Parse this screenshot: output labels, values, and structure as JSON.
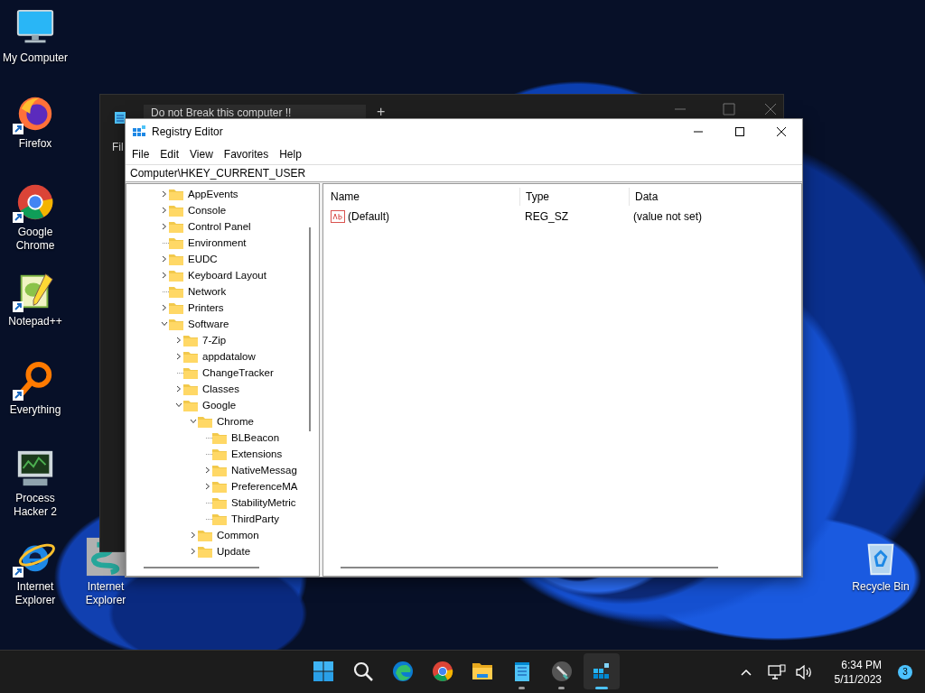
{
  "desktop_icons": [
    {
      "label": "My Computer",
      "kind": "monitor",
      "shortcut": false
    },
    {
      "label": "Firefox",
      "kind": "firefox",
      "shortcut": true
    },
    {
      "label": "Google Chrome",
      "kind": "chrome",
      "shortcut": true
    },
    {
      "label": "Notepad++",
      "kind": "notepadpp",
      "shortcut": true
    },
    {
      "label": "Everything",
      "kind": "magnifier",
      "shortcut": true
    },
    {
      "label": "Process Hacker 2",
      "kind": "hacker",
      "shortcut": false
    },
    {
      "label": "Internet Explorer",
      "kind": "ie",
      "shortcut": true
    },
    {
      "label": "Internet Explorer",
      "kind": "spring",
      "shortcut": false
    },
    {
      "label": "Recycle Bin",
      "kind": "bin",
      "shortcut": false
    }
  ],
  "background_window": {
    "tab_title": "Do not Break this computer !!",
    "new_tab": "+",
    "menu_partial": "Fil"
  },
  "registry_editor": {
    "title": "Registry Editor",
    "menu": [
      "File",
      "Edit",
      "View",
      "Favorites",
      "Help"
    ],
    "address": "Computer\\HKEY_CURRENT_USER",
    "tree": [
      {
        "name": "AppEvents",
        "has_subkeys": true,
        "expanded": false
      },
      {
        "name": "Console",
        "has_subkeys": true,
        "expanded": false
      },
      {
        "name": "Control Panel",
        "has_subkeys": true,
        "expanded": false
      },
      {
        "name": "Environment",
        "has_subkeys": false
      },
      {
        "name": "EUDC",
        "has_subkeys": true,
        "expanded": false
      },
      {
        "name": "Keyboard Layout",
        "has_subkeys": true,
        "expanded": false
      },
      {
        "name": "Network",
        "has_subkeys": false
      },
      {
        "name": "Printers",
        "has_subkeys": true,
        "expanded": false
      },
      {
        "name": "Software",
        "has_subkeys": true,
        "expanded": true,
        "children": [
          {
            "name": "7-Zip",
            "has_subkeys": true,
            "expanded": false
          },
          {
            "name": "appdatalow",
            "has_subkeys": true,
            "expanded": false
          },
          {
            "name": "ChangeTracker",
            "has_subkeys": false
          },
          {
            "name": "Classes",
            "has_subkeys": true,
            "expanded": false
          },
          {
            "name": "Google",
            "has_subkeys": true,
            "expanded": true,
            "children": [
              {
                "name": "Chrome",
                "has_subkeys": true,
                "expanded": true,
                "children": [
                  {
                    "name": "BLBeacon",
                    "has_subkeys": false
                  },
                  {
                    "name": "Extensions",
                    "has_subkeys": false
                  },
                  {
                    "name": "NativeMessag",
                    "has_subkeys": true,
                    "expanded": false
                  },
                  {
                    "name": "PreferenceMA",
                    "has_subkeys": true,
                    "expanded": false
                  },
                  {
                    "name": "StabilityMetric",
                    "has_subkeys": false
                  },
                  {
                    "name": "ThirdParty",
                    "has_subkeys": false
                  }
                ]
              },
              {
                "name": "Common",
                "has_subkeys": true,
                "expanded": false
              },
              {
                "name": "Update",
                "has_subkeys": true,
                "expanded": false
              }
            ]
          }
        ]
      }
    ],
    "columns": [
      "Name",
      "Type",
      "Data"
    ],
    "rows": [
      {
        "name": "(Default)",
        "type": "REG_SZ",
        "data": "(value not set)"
      }
    ]
  },
  "taskbar": {
    "apps": [
      {
        "kind": "start",
        "running": false,
        "active": false
      },
      {
        "kind": "search",
        "running": false,
        "active": false
      },
      {
        "kind": "edge",
        "running": false,
        "active": false
      },
      {
        "kind": "chrome",
        "running": false,
        "active": false
      },
      {
        "kind": "folder",
        "running": false,
        "active": false
      },
      {
        "kind": "notepad",
        "running": true,
        "active": false
      },
      {
        "kind": "hacker",
        "running": true,
        "active": false
      },
      {
        "kind": "regedit",
        "running": true,
        "active": true
      }
    ],
    "time": "6:34 PM",
    "date": "5/11/2023",
    "notification_count": "3"
  }
}
